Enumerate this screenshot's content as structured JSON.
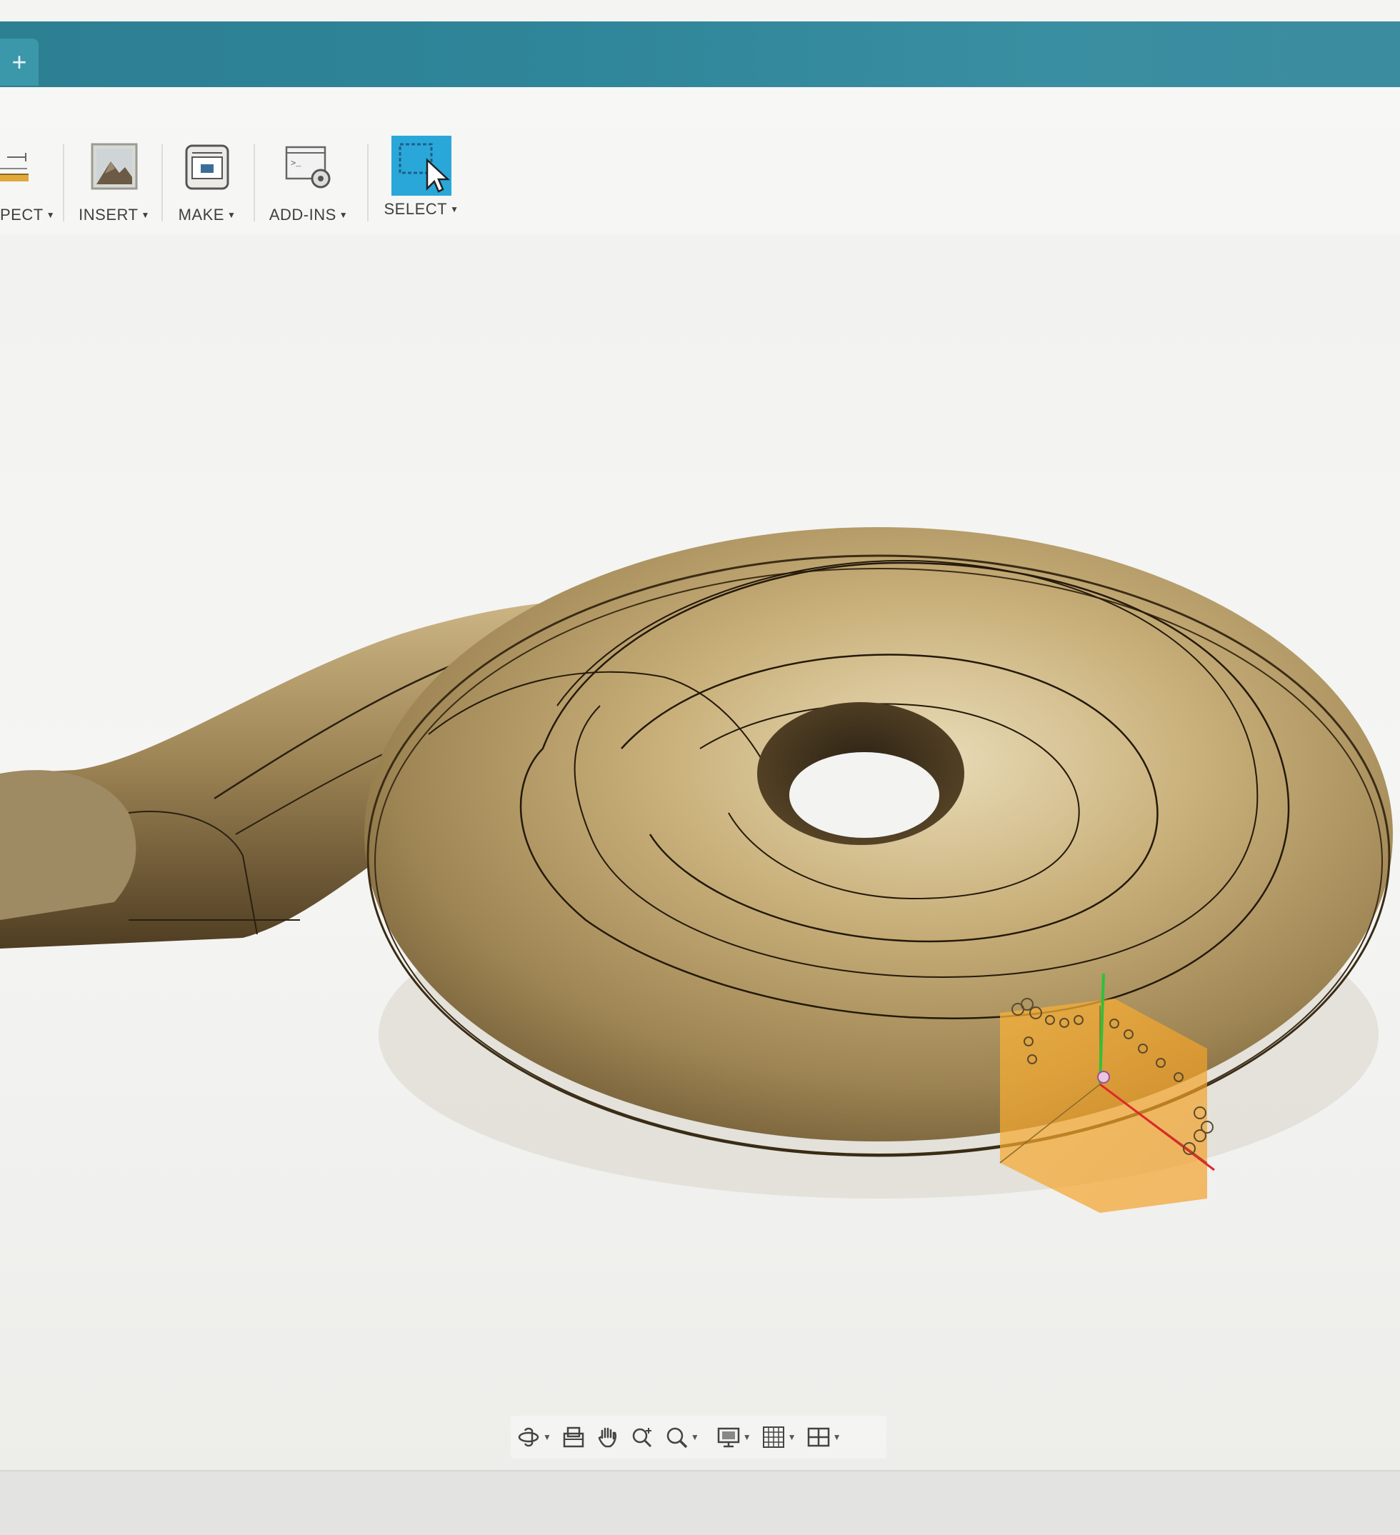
{
  "tabbar": {
    "new_tab_glyph": "+"
  },
  "toolbar": {
    "groups": [
      {
        "id": "inspect",
        "label": "PECT",
        "icon": "ruler-icon"
      },
      {
        "id": "insert",
        "label": "INSERT",
        "icon": "image-icon"
      },
      {
        "id": "make",
        "label": "MAKE",
        "icon": "3d-print-icon"
      },
      {
        "id": "addins",
        "label": "ADD-INS",
        "icon": "script-gear-icon"
      },
      {
        "id": "select",
        "label": "SELECT",
        "icon": "select-cursor-icon",
        "active": true
      }
    ]
  },
  "navigation_bar": {
    "items": [
      {
        "name": "orbit-icon",
        "dropdown": true
      },
      {
        "name": "look-at-icon",
        "dropdown": false
      },
      {
        "name": "pan-icon",
        "dropdown": false
      },
      {
        "name": "zoom-icon",
        "dropdown": false
      },
      {
        "name": "zoom-window-icon",
        "dropdown": true
      },
      {
        "name": "display-settings-icon",
        "dropdown": true
      },
      {
        "name": "grid-icon",
        "dropdown": true
      },
      {
        "name": "viewports-icon",
        "dropdown": true
      }
    ]
  },
  "colors": {
    "tabbar": "#2f8599",
    "select_active": "#2aa7d9",
    "model_body": "#a8905e",
    "model_highlight": "#e6d7b0",
    "model_shadow": "#5f4b2a",
    "selection_box": "#f6a623",
    "axis_y": "#2fc13a",
    "axis_x": "#e0282a"
  }
}
